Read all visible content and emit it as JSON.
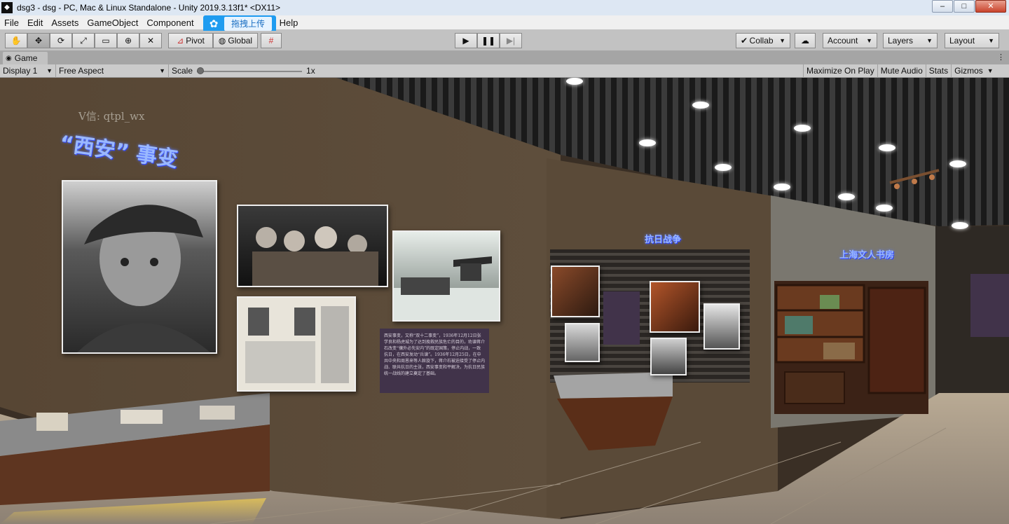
{
  "window": {
    "title": "dsg3 - dsg - PC, Mac & Linux Standalone - Unity 2019.3.13f1* <DX11>",
    "controls": [
      "–",
      "□",
      "✕"
    ]
  },
  "menu": {
    "items": [
      "File",
      "Edit",
      "Assets",
      "GameObject",
      "Component",
      "Help"
    ],
    "overlay_label": "拖拽上传"
  },
  "toolbar": {
    "pivot_label": "Pivot",
    "global_label": "Global",
    "collab_label": "Collab",
    "account_label": "Account",
    "layers_label": "Layers",
    "layout_label": "Layout"
  },
  "game_tab": {
    "label": "Game"
  },
  "game_view": {
    "display_label": "Display 1",
    "aspect_label": "Free Aspect",
    "scale_label": "Scale",
    "scale_value": "1x",
    "maximize_label": "Maximize On Play",
    "mute_label": "Mute Audio",
    "stats_label": "Stats",
    "gizmos_label": "Gizmos"
  },
  "scene": {
    "watermark": "V信: qtpl_wx",
    "sign_xian": "“西安” 事变",
    "sign_war": "抗日战争",
    "sign_study": "上海文人书房",
    "panel_text": "西安事变，又称“双十二事变”，1936年12月12日张学良和杨虎城为了达到挽救民族危亡的目的，劝谏蒋介石改变“攘外必先安内”的既定国策，停止内战，一致抗日，在西安发动“兵谏”。1936年12月25日，在中共中央和周恩来等人斡旋下，蒋介石被迫接受了停止内战、联共抗日的主张，西安事变和平解决，为抗日民族统一战线的建立奠定了基础。"
  }
}
